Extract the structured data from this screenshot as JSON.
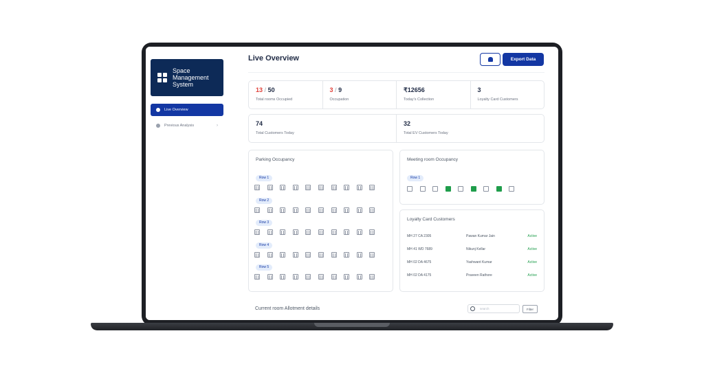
{
  "sidebar": {
    "brand_title": "Space Management System",
    "items": [
      {
        "label": "Live Overview",
        "active": true
      },
      {
        "label": "Previous Analysis",
        "active": false
      }
    ]
  },
  "header": {
    "title": "Live Overview",
    "notification_icon": "bell-icon",
    "export_label": "Export Data"
  },
  "colors": {
    "primary": "#1337a3",
    "brand_dark": "#0d2a57",
    "alert": "#e0413a",
    "active": "#1f9d4b"
  },
  "stats_row1": [
    {
      "occupied": "13",
      "total": "50",
      "label": "Total rooms Occupied"
    },
    {
      "occupied": "3",
      "total": "9",
      "label": "Occupation"
    },
    {
      "value": "₹12656",
      "label": "Today's Collection"
    },
    {
      "value": "3",
      "label": "Loyalty Card Customers"
    }
  ],
  "stats_row2": [
    {
      "value": "74",
      "label": "Total Customers Today"
    },
    {
      "value": "32",
      "label": "Total EV Customers Today"
    }
  ],
  "parking": {
    "title": "Parking Occupancy",
    "rows": [
      {
        "label": "Row 1",
        "slots": 10
      },
      {
        "label": "Row 2",
        "slots": 10
      },
      {
        "label": "Row 3",
        "slots": 10
      },
      {
        "label": "Row 4",
        "slots": 10
      },
      {
        "label": "Row 5",
        "slots": 10
      }
    ]
  },
  "meeting": {
    "title": "Meeting room Occupancy",
    "row_label": "Row 1",
    "rooms": [
      false,
      false,
      false,
      true,
      false,
      true,
      false,
      true,
      false
    ]
  },
  "loyalty": {
    "title": "Loyalty Card Customers",
    "rows": [
      {
        "plate": "MH 27 CA 2305",
        "name": "Pawan Kumar Jain",
        "status": "Active"
      },
      {
        "plate": "MH 41 WD 7689",
        "name": "Nikunj Kellar",
        "status": "Active"
      },
      {
        "plate": "MH 02 DA 4675",
        "name": "Yashwant Kumar",
        "status": "Active"
      },
      {
        "plate": "MH 02 DA 4175",
        "name": "Praveen Rathore",
        "status": "Active"
      }
    ]
  },
  "allotment": {
    "title": "Current room Allotment details",
    "search_placeholder": "search",
    "filter_label": "Filter"
  }
}
